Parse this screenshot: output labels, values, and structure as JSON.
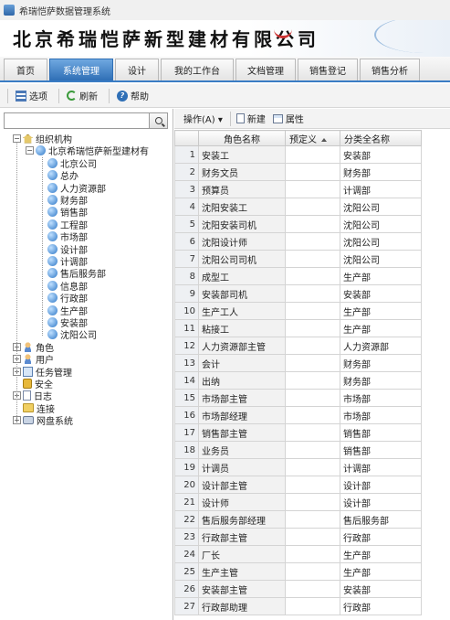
{
  "window": {
    "title": "希瑞恺萨数据管理系统"
  },
  "banner": {
    "company": "北京希瑞恺萨新型建材有限公司"
  },
  "tabs": [
    {
      "label": "首页",
      "active": false
    },
    {
      "label": "系统管理",
      "active": true
    },
    {
      "label": "设计",
      "active": false
    },
    {
      "label": "我的工作台",
      "active": false
    },
    {
      "label": "文档管理",
      "active": false
    },
    {
      "label": "销售登记",
      "active": false
    },
    {
      "label": "销售分析",
      "active": false
    }
  ],
  "toolbar": {
    "options_label": "选项",
    "refresh_label": "刷新",
    "help_label": "帮助"
  },
  "search": {
    "value": "",
    "placeholder": ""
  },
  "tree": {
    "org_label": "组织机构",
    "company_label": "北京希瑞恺萨新型建材有",
    "departments": [
      "北京公司",
      "总办",
      "人力资源部",
      "财务部",
      "销售部",
      "工程部",
      "市场部",
      "设计部",
      "计调部",
      "售后服务部",
      "信息部",
      "行政部",
      "生产部",
      "安装部",
      "沈阳公司"
    ],
    "other_nodes": [
      {
        "label": "角色",
        "icon": "people-icon",
        "expandable": true
      },
      {
        "label": "用户",
        "icon": "user-icon",
        "expandable": true
      },
      {
        "label": "任务管理",
        "icon": "task-icon",
        "expandable": true
      },
      {
        "label": "安全",
        "icon": "lock-icon",
        "expandable": false
      },
      {
        "label": "日志",
        "icon": "page-icon",
        "expandable": true
      },
      {
        "label": "连接",
        "icon": "folder-icon",
        "expandable": false
      },
      {
        "label": "网盘系统",
        "icon": "disk-icon",
        "expandable": true
      }
    ]
  },
  "right_toolbar": {
    "actions_label": "操作(A) ▾",
    "new_label": "新建",
    "props_label": "属性"
  },
  "grid": {
    "columns": [
      "",
      "角色名称",
      "预定义",
      "分类全名称"
    ],
    "rows": [
      {
        "n": "1",
        "name": "安装工",
        "predef": "",
        "category": "安装部"
      },
      {
        "n": "2",
        "name": "财务文员",
        "predef": "",
        "category": "财务部"
      },
      {
        "n": "3",
        "name": "预算员",
        "predef": "",
        "category": "计调部"
      },
      {
        "n": "4",
        "name": "沈阳安装工",
        "predef": "",
        "category": "沈阳公司"
      },
      {
        "n": "5",
        "name": "沈阳安装司机",
        "predef": "",
        "category": "沈阳公司"
      },
      {
        "n": "6",
        "name": "沈阳设计师",
        "predef": "",
        "category": "沈阳公司"
      },
      {
        "n": "7",
        "name": "沈阳公司司机",
        "predef": "",
        "category": "沈阳公司"
      },
      {
        "n": "8",
        "name": "成型工",
        "predef": "",
        "category": "生产部"
      },
      {
        "n": "9",
        "name": "安装部司机",
        "predef": "",
        "category": "安装部"
      },
      {
        "n": "10",
        "name": "生产工人",
        "predef": "",
        "category": "生产部"
      },
      {
        "n": "11",
        "name": "粘接工",
        "predef": "",
        "category": "生产部"
      },
      {
        "n": "12",
        "name": "人力资源部主管",
        "predef": "",
        "category": "人力资源部"
      },
      {
        "n": "13",
        "name": "会计",
        "predef": "",
        "category": "财务部"
      },
      {
        "n": "14",
        "name": "出纳",
        "predef": "",
        "category": "财务部"
      },
      {
        "n": "15",
        "name": "市场部主管",
        "predef": "",
        "category": "市场部"
      },
      {
        "n": "16",
        "name": "市场部经理",
        "predef": "",
        "category": "市场部"
      },
      {
        "n": "17",
        "name": "销售部主管",
        "predef": "",
        "category": "销售部"
      },
      {
        "n": "18",
        "name": "业务员",
        "predef": "",
        "category": "销售部"
      },
      {
        "n": "19",
        "name": "计调员",
        "predef": "",
        "category": "计调部"
      },
      {
        "n": "20",
        "name": "设计部主管",
        "predef": "",
        "category": "设计部"
      },
      {
        "n": "21",
        "name": "设计师",
        "predef": "",
        "category": "设计部"
      },
      {
        "n": "22",
        "name": "售后服务部经理",
        "predef": "",
        "category": "售后服务部"
      },
      {
        "n": "23",
        "name": "行政部主管",
        "predef": "",
        "category": "行政部"
      },
      {
        "n": "24",
        "name": "厂长",
        "predef": "",
        "category": "生产部"
      },
      {
        "n": "25",
        "name": "生产主管",
        "predef": "",
        "category": "生产部"
      },
      {
        "n": "26",
        "name": "安装部主管",
        "predef": "",
        "category": "安装部"
      },
      {
        "n": "27",
        "name": "行政部助理",
        "predef": "",
        "category": "行政部"
      }
    ]
  }
}
